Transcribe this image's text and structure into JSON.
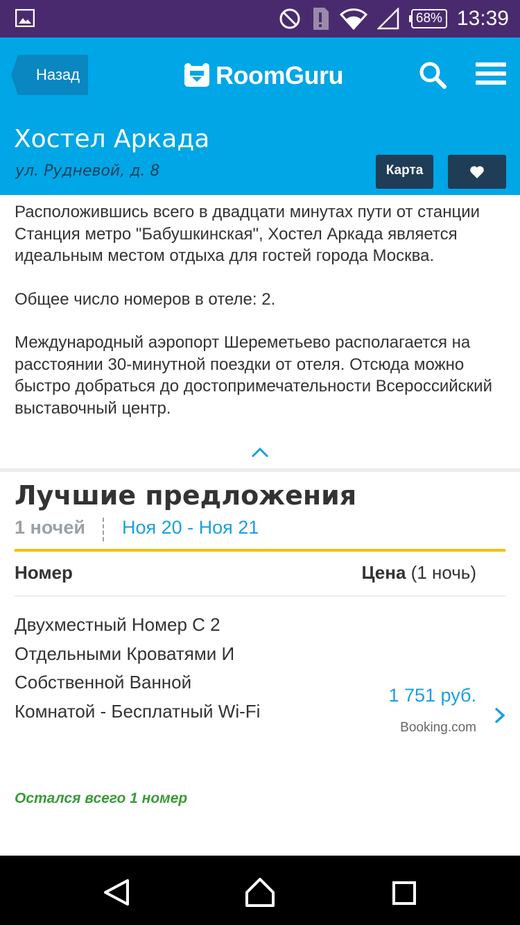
{
  "status_bar": {
    "battery": "68%",
    "time": "13:39",
    "icons": [
      "image-icon",
      "do-not-disturb-icon",
      "alert-icon",
      "wifi-icon",
      "signal-icon",
      "battery-icon"
    ]
  },
  "header": {
    "back_label": "Назад",
    "logo_text": "RoomGuru",
    "hotel_name": "Хостел Аркада",
    "address": "ул. Рудневой, д. 8",
    "map_label": "Карта",
    "colors": {
      "header_bg": "#00a6e6",
      "dark_button": "#1f3d57"
    }
  },
  "description": {
    "paragraphs": [
      "Расположившись всего в двадцати минутах пути от станции Станция метро \"Бабушкинская\", Хостел Аркада является идеальным местом отдыха для гостей города Москва.",
      "Общее число номеров в отеле: 2.",
      "Международный аэропорт Шереметьево располагается на расстоянии 30-минутной поездки от отеля. Отсюда можно быстро добраться до достопримечательности Всероссийский выставочный центр."
    ]
  },
  "offers": {
    "title": "Лучшие предложения",
    "nights": "1 ночей",
    "dates": "Ноя 20 - Ноя 21",
    "col_room": "Номер",
    "col_price_bold": "Цена",
    "col_price_rest": " (1 ночь)",
    "rooms": [
      {
        "name": "Двухместный Номер С 2 Отдельными Кроватями И Собственной Ванной Комнатой - Бесплатный Wi-Fi",
        "availability": "Остался всего 1 номер",
        "price": "1 751 руб.",
        "provider": "Booking.com"
      }
    ]
  }
}
